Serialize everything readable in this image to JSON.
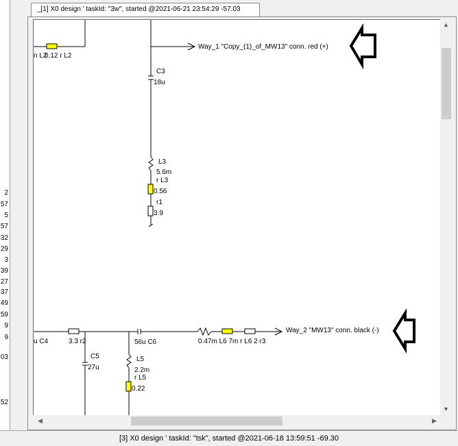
{
  "left_panel_numbers": [
    "2",
    "57",
    "5",
    "57",
    "32",
    "29",
    "3",
    "39",
    "27",
    "37",
    "49",
    "59",
    "9",
    "9",
    "03",
    "52"
  ],
  "tab": {
    "label": "_[1] X0 design ' taskId: \"3w\", started @2021-06-21 23:54:29 -57.03"
  },
  "schematic": {
    "top_left_label": "n L2",
    "top_left_value": "0.12 r L2",
    "way1_label": "Way_1 \"Copy_(1)_of_MW13\" conn. red (+)",
    "c3_name": "C3",
    "c3_value": "18u",
    "l3_name": "L3",
    "l3_value": "5.6m",
    "rl3_name": "r L3",
    "rl3_value": "0.56",
    "r1_name": "r1",
    "r1_value": "3.9",
    "c4_label": "u C4",
    "r2_label": "3.3 r2",
    "c5_name": "C5",
    "c5_value": "27u",
    "c6_label": "56u C6",
    "l5_name": "L5",
    "l5_value": "2.2m",
    "rl5_name": "r L5",
    "rl5_value": "0.22",
    "series_labels": "0.47m L6 7m r L6 2 r3",
    "way2_label": "Way_2 \"MW13\" conn. black (-)"
  },
  "scroll": {
    "up": "▲",
    "down": "▼",
    "left": "◀",
    "right": "▶"
  },
  "status_bar": {
    "text": "[3] X0 design ' taskId: \"tsk\", started @2021-06-18 13:59:51 -69.30"
  },
  "colors": {
    "component_fill": "#ffff00",
    "arrow_stroke": "#000000"
  },
  "icons": {
    "arrow_up": "up-arrow-icon",
    "arrow_down": "down-arrow-icon"
  }
}
